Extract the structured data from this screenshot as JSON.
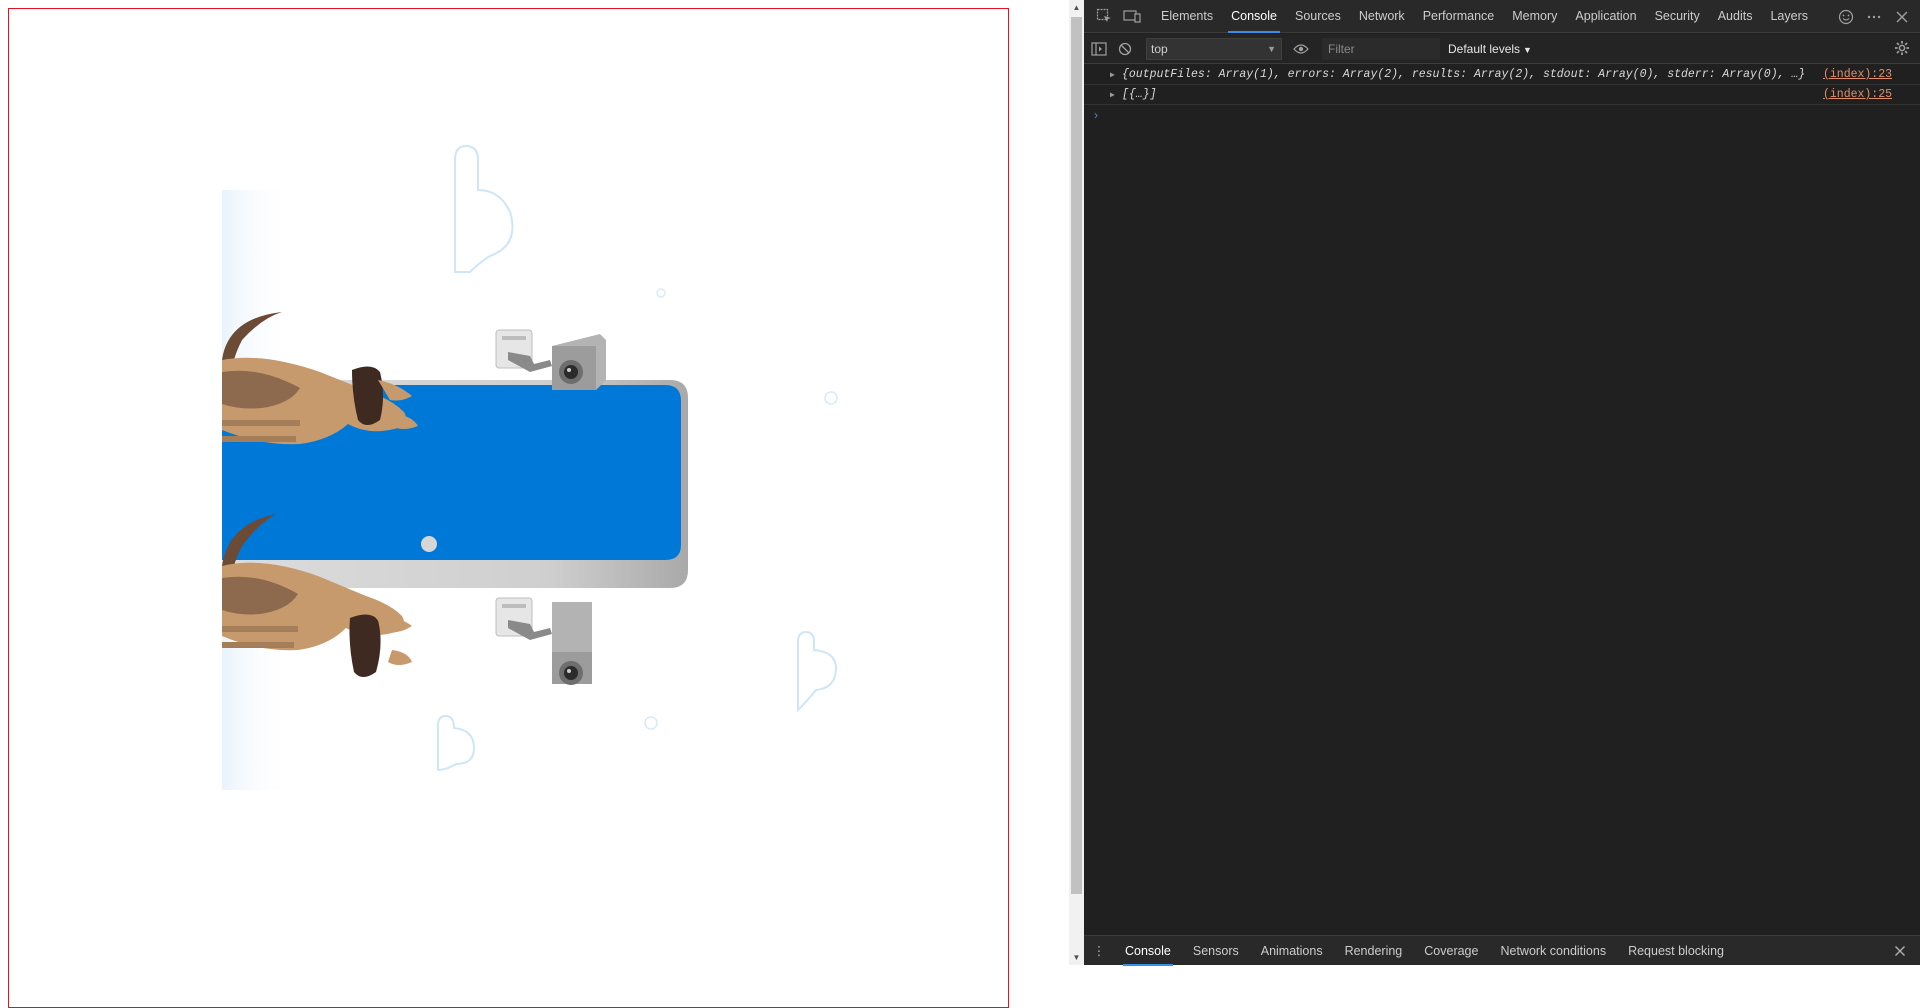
{
  "devtools": {
    "tabs": [
      {
        "label": "Elements"
      },
      {
        "label": "Console"
      },
      {
        "label": "Sources"
      },
      {
        "label": "Network"
      },
      {
        "label": "Performance"
      },
      {
        "label": "Memory"
      },
      {
        "label": "Application"
      },
      {
        "label": "Security"
      },
      {
        "label": "Audits"
      },
      {
        "label": "Layers"
      }
    ],
    "active_tab": "Console",
    "console_bar": {
      "context": "top",
      "filter_placeholder": "Filter",
      "levels": "Default levels"
    },
    "log": [
      {
        "message": "{outputFiles: Array(1), errors: Array(2), results: Array(2), stdout: Array(0), stderr: Array(0), …}",
        "source": "(index):23"
      },
      {
        "message": "[{…}]",
        "source": "(index):25"
      }
    ],
    "drawer_tabs": [
      {
        "label": "Console"
      },
      {
        "label": "Sensors"
      },
      {
        "label": "Animations"
      },
      {
        "label": "Rendering"
      },
      {
        "label": "Coverage"
      },
      {
        "label": "Network conditions"
      },
      {
        "label": "Request blocking"
      }
    ],
    "accent": "#3b8ee8"
  },
  "illustration": {
    "panel_color": "#0078d7",
    "frame_color": "#e81123",
    "icons": [
      "dog-icon",
      "security-camera-icon",
      "cloud-icon"
    ]
  }
}
